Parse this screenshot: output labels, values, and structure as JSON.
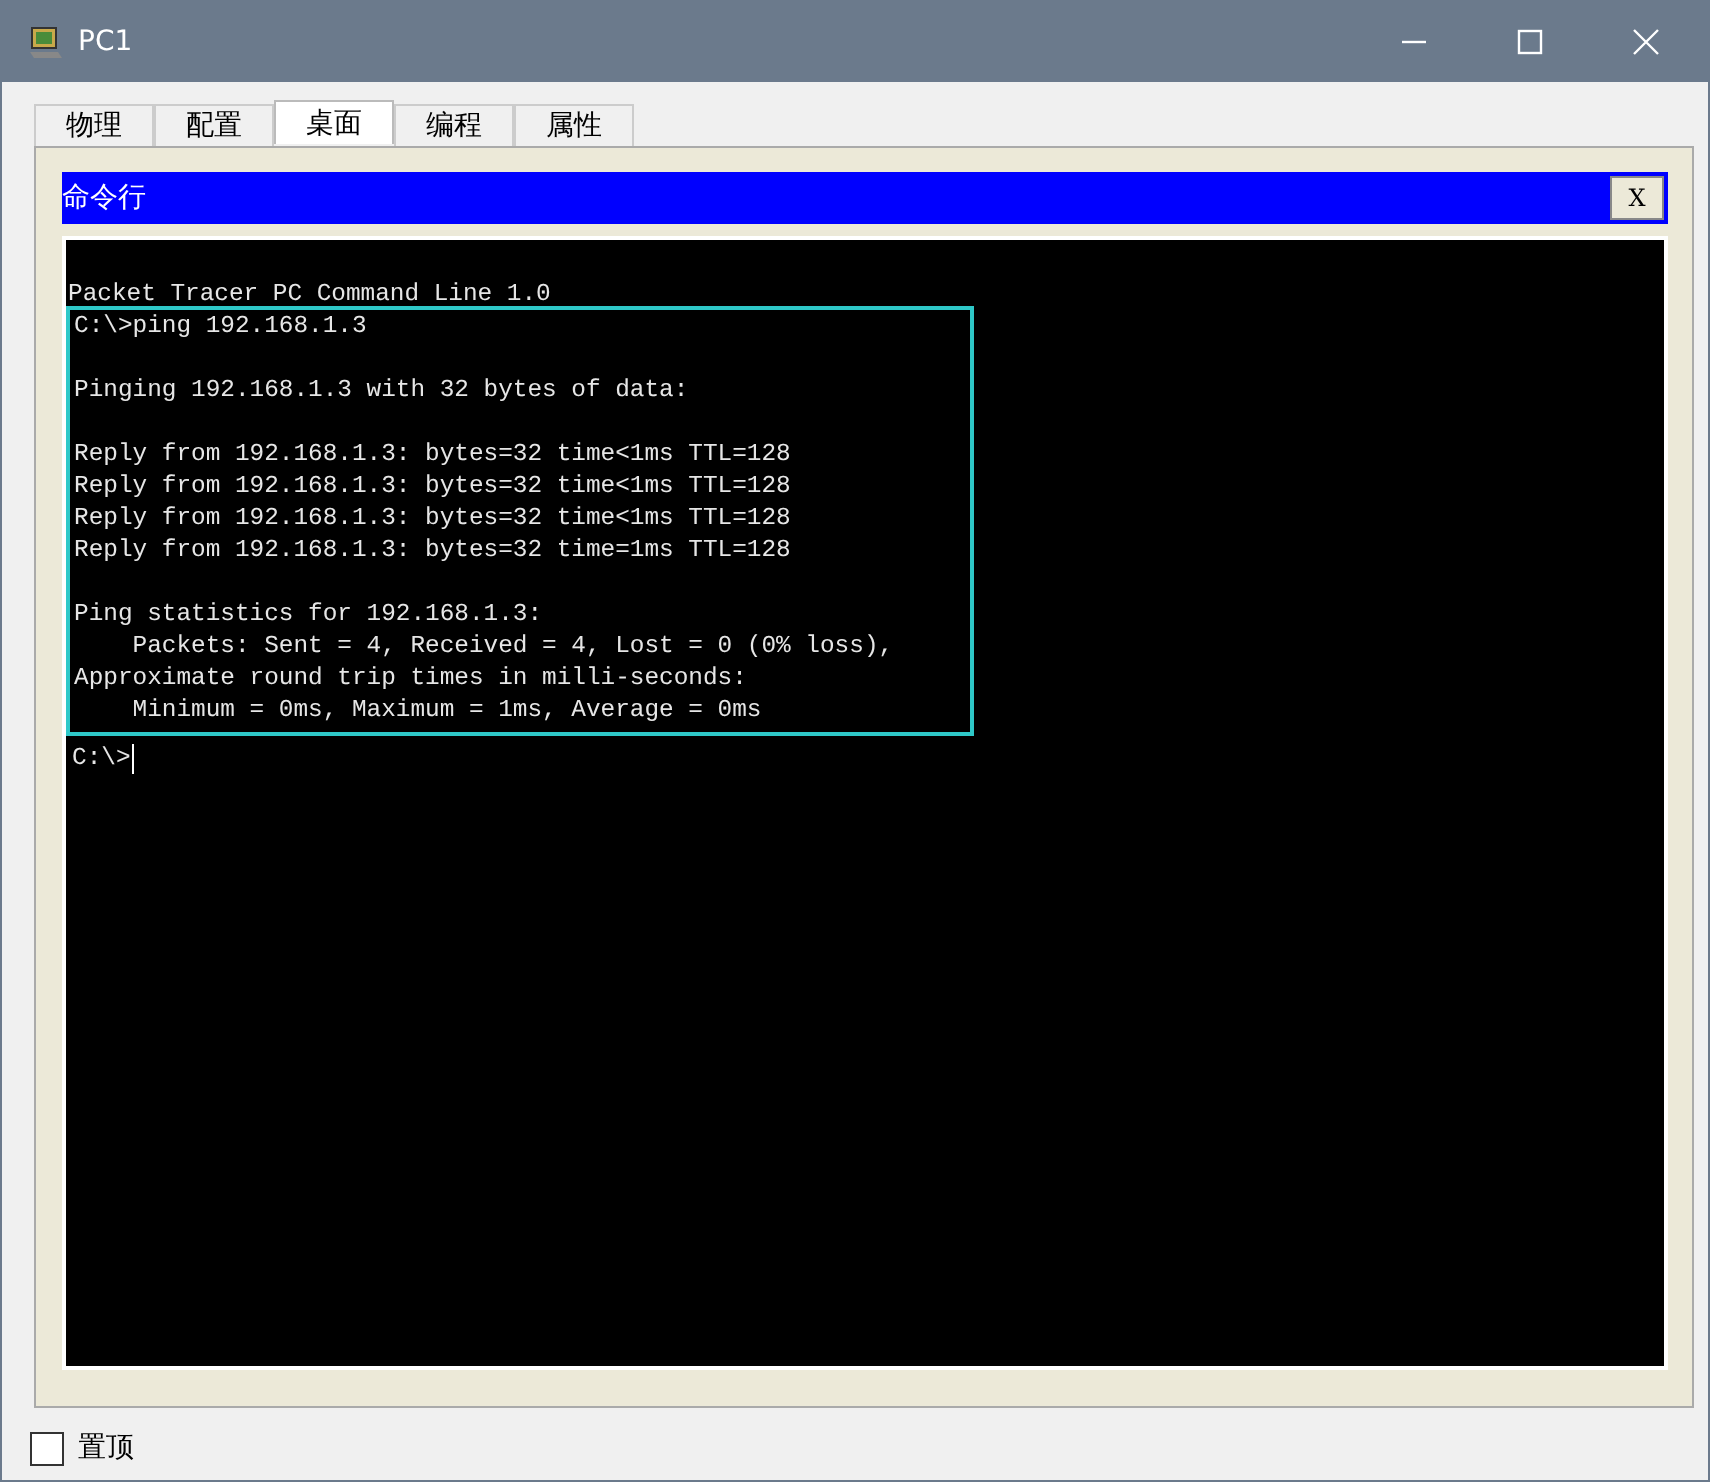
{
  "window": {
    "title": "PC1"
  },
  "tabs": [
    {
      "label": "物理",
      "selected": false
    },
    {
      "label": "配置",
      "selected": false
    },
    {
      "label": "桌面",
      "selected": true
    },
    {
      "label": "编程",
      "selected": false
    },
    {
      "label": "属性",
      "selected": false
    }
  ],
  "panel": {
    "title": "命令行",
    "close": "X"
  },
  "terminal": {
    "header": "Packet Tracer PC Command Line 1.0",
    "highlighted_paragraphs": [
      [
        "C:\\>ping 192.168.1.3"
      ],
      [
        "Pinging 192.168.1.3 with 32 bytes of data:"
      ],
      [
        "Reply from 192.168.1.3: bytes=32 time<1ms TTL=128",
        "Reply from 192.168.1.3: bytes=32 time<1ms TTL=128",
        "Reply from 192.168.1.3: bytes=32 time<1ms TTL=128",
        "Reply from 192.168.1.3: bytes=32 time=1ms TTL=128"
      ],
      [
        "Ping statistics for 192.168.1.3:",
        "    Packets: Sent = 4, Received = 4, Lost = 0 (0% loss),",
        "Approximate round trip times in milli-seconds:",
        "    Minimum = 0ms, Maximum = 1ms, Average = 0ms"
      ]
    ],
    "prompt": "C:\\>"
  },
  "always_on_top": {
    "label": "置顶",
    "checked": false
  }
}
